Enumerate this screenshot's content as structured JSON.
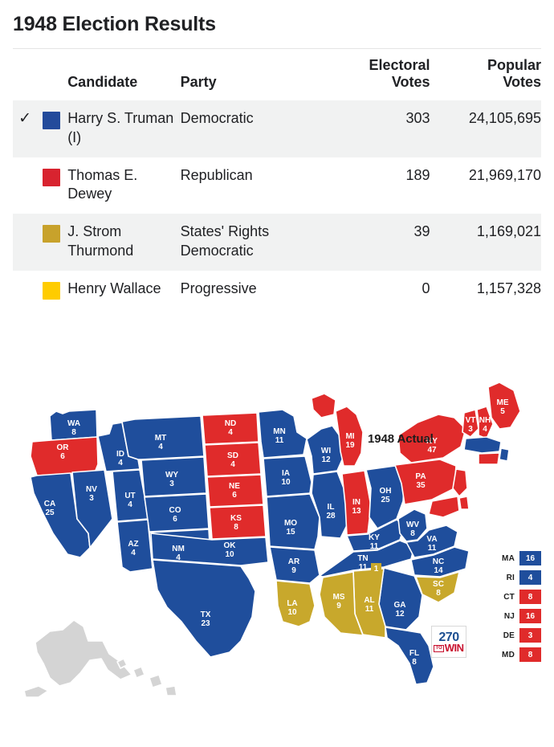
{
  "page_title": "1948 Election Results",
  "table": {
    "headers": {
      "check": "",
      "swatch": "",
      "candidate": "Candidate",
      "party": "Party",
      "electoral_votes": "Electoral Votes",
      "electoral_votes_l1": "Electoral",
      "electoral_votes_l2": "Votes",
      "popular_votes": "Popular Votes",
      "popular_votes_l1": "Popular",
      "popular_votes_l2": "Votes"
    },
    "rows": [
      {
        "winner_check": "✓",
        "color": "#234B9B",
        "candidate": "Harry S. Truman (I)",
        "party": "Democratic",
        "electoral_votes": "303",
        "popular_votes": "24,105,695"
      },
      {
        "winner_check": "",
        "color": "#D8232F",
        "candidate": "Thomas E. Dewey",
        "party": "Republican",
        "electoral_votes": "189",
        "popular_votes": "21,969,170"
      },
      {
        "winner_check": "",
        "color": "#C8A22B",
        "candidate": "J. Strom Thurmond",
        "party": "States' Rights Democratic",
        "electoral_votes": "39",
        "popular_votes": "1,169,021"
      },
      {
        "winner_check": "",
        "color": "#FFCC00",
        "candidate": "Henry Wallace",
        "party": "Progressive",
        "electoral_votes": "0",
        "popular_votes": "1,157,328"
      }
    ]
  },
  "map": {
    "annotation": "1948 Actual",
    "colors": {
      "democratic": "#1F4E9C",
      "republican": "#E02B2B",
      "states_rights": "#C8A82C",
      "not_a_state": "#D4D4D4",
      "border": "#ffffff"
    },
    "states": [
      {
        "abbr": "WA",
        "ev": "8",
        "party": "democratic"
      },
      {
        "abbr": "OR",
        "ev": "6",
        "party": "republican"
      },
      {
        "abbr": "ID",
        "ev": "4",
        "party": "democratic"
      },
      {
        "abbr": "MT",
        "ev": "4",
        "party": "democratic"
      },
      {
        "abbr": "WY",
        "ev": "3",
        "party": "democratic"
      },
      {
        "abbr": "NV",
        "ev": "3",
        "party": "democratic"
      },
      {
        "abbr": "UT",
        "ev": "4",
        "party": "democratic"
      },
      {
        "abbr": "CO",
        "ev": "6",
        "party": "democratic"
      },
      {
        "abbr": "CA",
        "ev": "25",
        "party": "democratic"
      },
      {
        "abbr": "AZ",
        "ev": "4",
        "party": "democratic"
      },
      {
        "abbr": "NM",
        "ev": "4",
        "party": "democratic"
      },
      {
        "abbr": "ND",
        "ev": "4",
        "party": "republican"
      },
      {
        "abbr": "SD",
        "ev": "4",
        "party": "republican"
      },
      {
        "abbr": "NE",
        "ev": "6",
        "party": "republican"
      },
      {
        "abbr": "KS",
        "ev": "8",
        "party": "republican"
      },
      {
        "abbr": "OK",
        "ev": "10",
        "party": "democratic"
      },
      {
        "abbr": "TX",
        "ev": "23",
        "party": "democratic"
      },
      {
        "abbr": "MN",
        "ev": "11",
        "party": "democratic"
      },
      {
        "abbr": "IA",
        "ev": "10",
        "party": "democratic"
      },
      {
        "abbr": "MO",
        "ev": "15",
        "party": "democratic"
      },
      {
        "abbr": "AR",
        "ev": "9",
        "party": "democratic"
      },
      {
        "abbr": "LA",
        "ev": "10",
        "party": "states_rights"
      },
      {
        "abbr": "MS",
        "ev": "9",
        "party": "states_rights"
      },
      {
        "abbr": "AL",
        "ev": "11",
        "party": "states_rights"
      },
      {
        "abbr": "WI",
        "ev": "12",
        "party": "democratic"
      },
      {
        "abbr": "IL",
        "ev": "28",
        "party": "democratic"
      },
      {
        "abbr": "MI",
        "ev": "19",
        "party": "republican"
      },
      {
        "abbr": "IN",
        "ev": "13",
        "party": "republican"
      },
      {
        "abbr": "OH",
        "ev": "25",
        "party": "democratic"
      },
      {
        "abbr": "KY",
        "ev": "11",
        "party": "democratic"
      },
      {
        "abbr": "TN",
        "ev": "11",
        "party": "democratic"
      },
      {
        "abbr": "TN",
        "ev": "1",
        "party": "states_rights"
      },
      {
        "abbr": "WV",
        "ev": "8",
        "party": "democratic"
      },
      {
        "abbr": "VA",
        "ev": "11",
        "party": "democratic"
      },
      {
        "abbr": "NC",
        "ev": "14",
        "party": "democratic"
      },
      {
        "abbr": "SC",
        "ev": "8",
        "party": "states_rights"
      },
      {
        "abbr": "GA",
        "ev": "12",
        "party": "democratic"
      },
      {
        "abbr": "FL",
        "ev": "8",
        "party": "democratic"
      },
      {
        "abbr": "PA",
        "ev": "35",
        "party": "republican"
      },
      {
        "abbr": "NY",
        "ev": "47",
        "party": "republican"
      },
      {
        "abbr": "VT",
        "ev": "3",
        "party": "republican"
      },
      {
        "abbr": "NH",
        "ev": "4",
        "party": "republican"
      },
      {
        "abbr": "ME",
        "ev": "5",
        "party": "republican"
      }
    ],
    "small_states": [
      {
        "abbr": "MA",
        "ev": "16",
        "party": "democratic"
      },
      {
        "abbr": "RI",
        "ev": "4",
        "party": "democratic"
      },
      {
        "abbr": "CT",
        "ev": "8",
        "party": "republican"
      },
      {
        "abbr": "NJ",
        "ev": "16",
        "party": "republican"
      },
      {
        "abbr": "DE",
        "ev": "3",
        "party": "republican"
      },
      {
        "abbr": "MD",
        "ev": "8",
        "party": "republican"
      }
    ],
    "logo": {
      "number": "270",
      "to": "TO",
      "win": "WIN"
    }
  }
}
